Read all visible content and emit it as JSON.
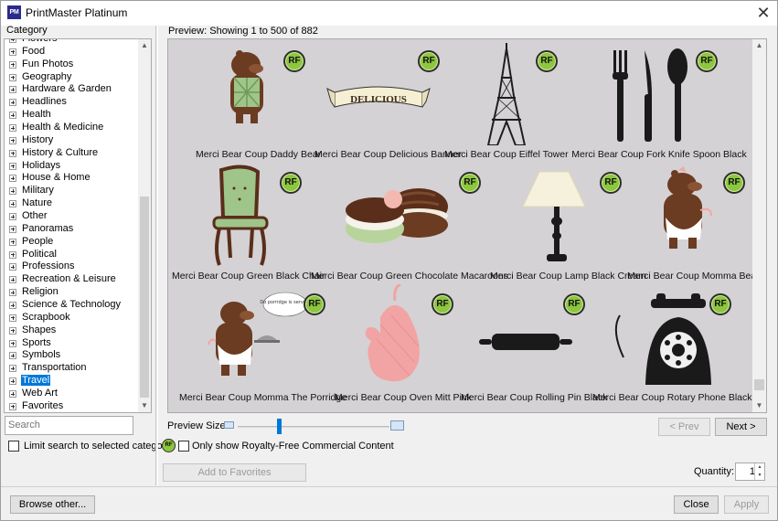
{
  "window": {
    "title": "PrintMaster Platinum",
    "icon_text": "PM"
  },
  "category": {
    "label": "Category",
    "items": [
      "Flowers",
      "Food",
      "Fun Photos",
      "Geography",
      "Hardware & Garden",
      "Headlines",
      "Health",
      "Health & Medicine",
      "History",
      "History & Culture",
      "Holidays",
      "House & Home",
      "Military",
      "Nature",
      "Other",
      "Panoramas",
      "People",
      "Political",
      "Professions",
      "Recreation & Leisure",
      "Religion",
      "Science & Technology",
      "Scrapbook",
      "Shapes",
      "Sports",
      "Symbols",
      "Transportation",
      "Travel",
      "Web Art",
      "Favorites"
    ],
    "selected": "Travel"
  },
  "search": {
    "placeholder": "Search"
  },
  "limit_search_label": "Limit search to selected category",
  "preview": {
    "header": "Preview: Showing 1 to 500 of 882",
    "badge": "RF",
    "items": [
      "Merci Bear Coup Daddy Bear",
      "Merci Bear Coup Delicious Banner",
      "Merci Bear Coup Eiffel Tower",
      "Merci Bear Coup Fork Knife Spoon Black",
      "Merci Bear Coup Green Black Chair",
      "Merci Bear Coup Green Chocolate Macaroons",
      "Merci Bear Coup Lamp Black Cream",
      "Merci Bear Coup Momma Bear",
      "Merci Bear Coup Momma The Porridge",
      "Merci Bear Coup Oven Mitt Pink",
      "Merci Bear Coup Rolling Pin Black",
      "Merci Bear Coup Rotary Phone Black"
    ],
    "banner_text": "DELICIOUS",
    "speech_text": "Do porridge is served."
  },
  "preview_size_label": "Preview Size:",
  "buttons": {
    "prev": "< Prev",
    "next": "Next >",
    "add_favorites": "Add to Favorites",
    "browse_other": "Browse other...",
    "close": "Close",
    "apply": "Apply"
  },
  "rf_filter_label": "Only show Royalty-Free Commercial Content",
  "rf_icon_text": "RF",
  "quantity": {
    "label": "Quantity:",
    "value": "1"
  },
  "colors": {
    "selection": "#0078d7",
    "rf_badge": "#8dc63f",
    "preview_bg": "#d4d2d4"
  }
}
